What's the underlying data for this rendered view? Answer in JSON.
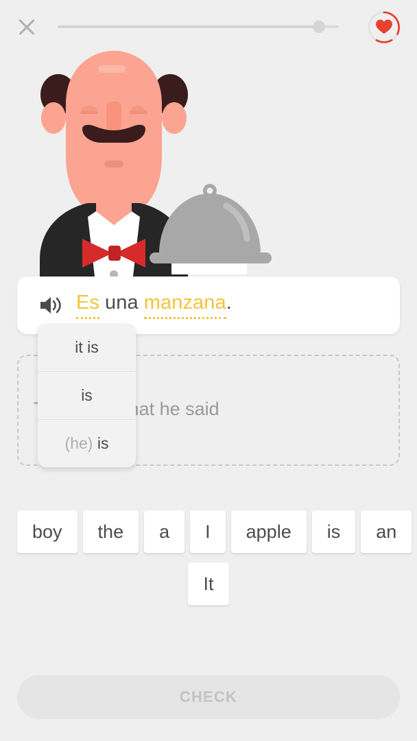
{
  "header": {
    "close_icon": "close-x-icon",
    "progress": {
      "value_percent": 93,
      "track_color": "#dcdcdc",
      "knob_color": "#d6d6d6"
    },
    "hearts": {
      "icon": "heart-icon",
      "heart_color": "#e8422f",
      "ring_color": "#e8422f",
      "ring_track_color": "#e0e0e0"
    }
  },
  "character": {
    "name": "waiter-illustration",
    "skin_color": "#fba491",
    "skin_shadow": "#f79580",
    "hair_color": "#3a1c1c",
    "suit_color": "#262626",
    "shirt_color": "#ffffff",
    "bowtie_color": "#d72b2b",
    "cloche_color": "#a8a8a8",
    "cloche_shine": "#bcbcbc"
  },
  "sentence": {
    "speaker_icon": "speaker-volume-icon",
    "tokens": [
      {
        "text": "Es",
        "hinted": true
      },
      {
        "text": "una",
        "hinted": false
      },
      {
        "text": "manzana",
        "hinted": true
      },
      {
        "text": ".",
        "hinted": false
      }
    ],
    "highlight_color": "#f5c33c",
    "text_color": "#4b4b4b"
  },
  "hint_popup": {
    "anchor_word": "Es",
    "options": [
      {
        "label": "it is",
        "muted": false
      },
      {
        "label": "is",
        "muted": false
      },
      {
        "label": "(he) is",
        "muted": true,
        "muted_prefix": "(he)",
        "strong_suffix": "is"
      }
    ]
  },
  "answer_area": {
    "placeholder": "Translate what he said",
    "border_color": "#c8c8c8"
  },
  "word_bank": {
    "rows": [
      [
        "boy",
        "the",
        "a",
        "I",
        "apple",
        "is",
        "an"
      ],
      [
        "It"
      ]
    ]
  },
  "check_button": {
    "label": "CHECK",
    "disabled": true,
    "background": "#e5e5e5",
    "text_color": "#c3c3c3"
  }
}
